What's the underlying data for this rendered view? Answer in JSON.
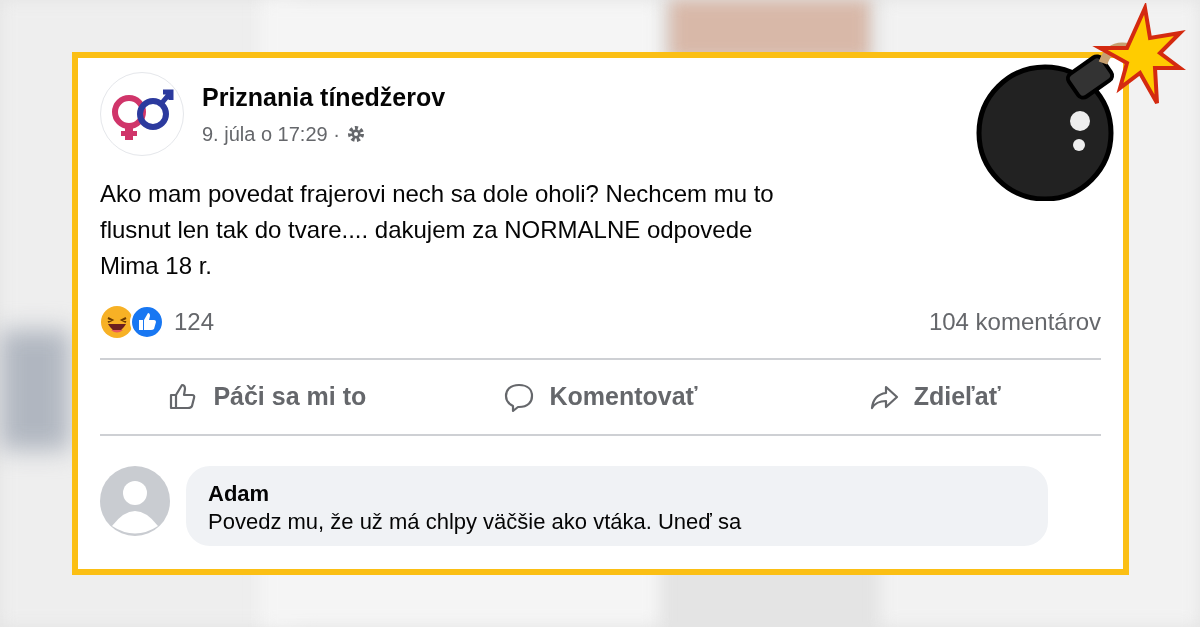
{
  "post": {
    "page_name": "Priznania tínedžerov",
    "timestamp": "9. júla o 17:29 ·",
    "text_lines": [
      "Ako mam povedat frajerovi nech sa dole oholi? Nechcem mu to",
      "flusnut len tak do tvare.... dakujem za NORMALNE odpovede",
      "Mima 18 r."
    ],
    "reaction_count": "124",
    "comment_count": "104 komentárov",
    "actions": [
      {
        "kind": "like",
        "label": "Páči sa mi to"
      },
      {
        "kind": "comment",
        "label": "Komentovať"
      },
      {
        "kind": "share",
        "label": "Zdieľať"
      }
    ]
  },
  "comment": {
    "author": "Adam",
    "text": "Povedz mu, že už má chlpy väčšie ako vtáka. Uneď sa"
  }
}
